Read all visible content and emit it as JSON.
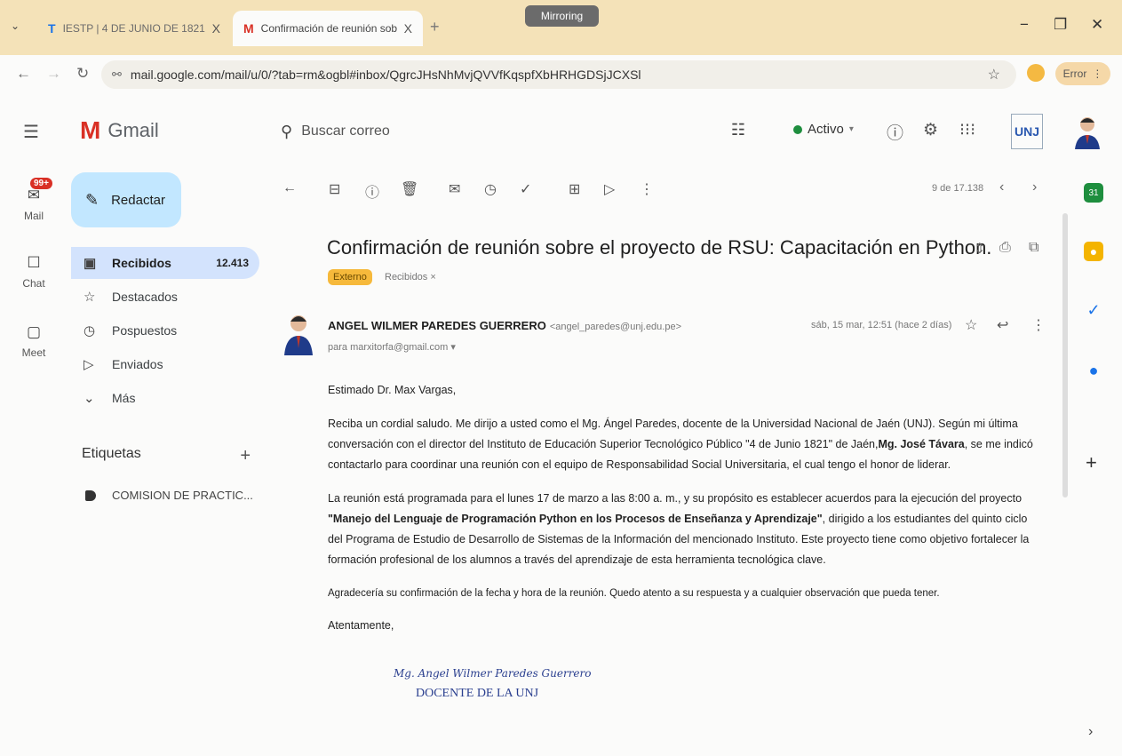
{
  "browser": {
    "tabs": [
      {
        "favicon": "T",
        "title": "IESTP | 4 DE JUNIO DE 1821",
        "close": "X"
      },
      {
        "favicon": "M",
        "title": "Confirmación de reunión sobre",
        "close": "X"
      }
    ],
    "new_tab": "+",
    "mirroring": "Mirroring",
    "url": "mail.google.com/mail/u/0/?tab=rm&ogbl#inbox/QgrcJHsNhMvjQVVfKqspfXbHRHGDSjJCXSl",
    "error_label": "Error"
  },
  "gmail": {
    "app_name": "Gmail",
    "search_placeholder": "Buscar correo",
    "status": "Activo",
    "org_logo": "UNJ"
  },
  "rail": {
    "badge": "99+",
    "items": [
      {
        "label": "Mail",
        "icon": "mail-icon"
      },
      {
        "label": "Chat",
        "icon": "chat-icon"
      },
      {
        "label": "Meet",
        "icon": "meet-icon"
      }
    ]
  },
  "nav": {
    "compose": "Redactar",
    "items": [
      {
        "label": "Recibidos",
        "count": "12.413",
        "icon": "inbox-icon"
      },
      {
        "label": "Destacados",
        "count": "",
        "icon": "star-icon"
      },
      {
        "label": "Pospuestos",
        "count": "",
        "icon": "clock-icon"
      },
      {
        "label": "Enviados",
        "count": "",
        "icon": "send-icon"
      },
      {
        "label": "Más",
        "count": "",
        "icon": "chevron-down-icon"
      }
    ],
    "labels_heading": "Etiquetas",
    "labels": [
      "COMISION DE PRACTIC..."
    ]
  },
  "toolbar": {
    "pager": "9 de 17.138"
  },
  "message": {
    "subject": "Confirmación de reunión sobre el proyecto de RSU: Capacitación en Python.",
    "badge_external": "Externo",
    "badge_inbox": "Recibidos ×",
    "sender_name": "ANGEL WILMER PAREDES GUERRERO",
    "sender_email": "<angel_paredes@unj.edu.pe>",
    "recipient": "para marxitorfa@gmail.com ▾",
    "date": "sáb, 15 mar, 12:51 (hace 2 días)",
    "greeting": "Estimado Dr. Max Vargas,",
    "p1_a": "Reciba un cordial saludo. Me dirijo a usted como el Mg. Ángel Paredes, docente de la Universidad Nacional de Jaén (UNJ). Según mi última conversación con el director del Instituto de Educación Superior Tecnológico Público \"4 de Junio 1821\" de Jaén,",
    "p1_bold": "Mg. José Távara",
    "p1_b": ", se me indicó contactarlo para coordinar una reunión con el equipo de Responsabilidad Social Universitaria, el cual tengo el honor de liderar.",
    "p2_a": "La reunión está programada para el lunes 17 de marzo a las 8:00 a. m., y su propósito es establecer acuerdos para la ejecución del proyecto ",
    "p2_bold": "\"Manejo del Lenguaje de Programación Python en los Procesos de Enseñanza y Aprendizaje\"",
    "p2_b": ", dirigido a los estudiantes del quinto ciclo del Programa de Estudio de Desarrollo de Sistemas de la Información del mencionado Instituto. Este proyecto tiene como objetivo fortalecer la formación profesional de los alumnos a través del aprendizaje de esta herramienta tecnológica clave.",
    "p3": "Agradecería su confirmación de la fecha y hora de la reunión. Quedo atento a su respuesta y a cualquier observación que pueda tener.",
    "closing": "Atentamente,",
    "signature_name": "Mg. Angel Wilmer Paredes Guerrero",
    "signature_title": "DOCENTE DE LA UNJ"
  },
  "colors": {
    "tabbar": "#f4e2b8",
    "compose": "#c2e7ff",
    "active_nav": "#d3e3fd",
    "external_badge": "#f6b93b",
    "signature": "#2a3f8f"
  }
}
